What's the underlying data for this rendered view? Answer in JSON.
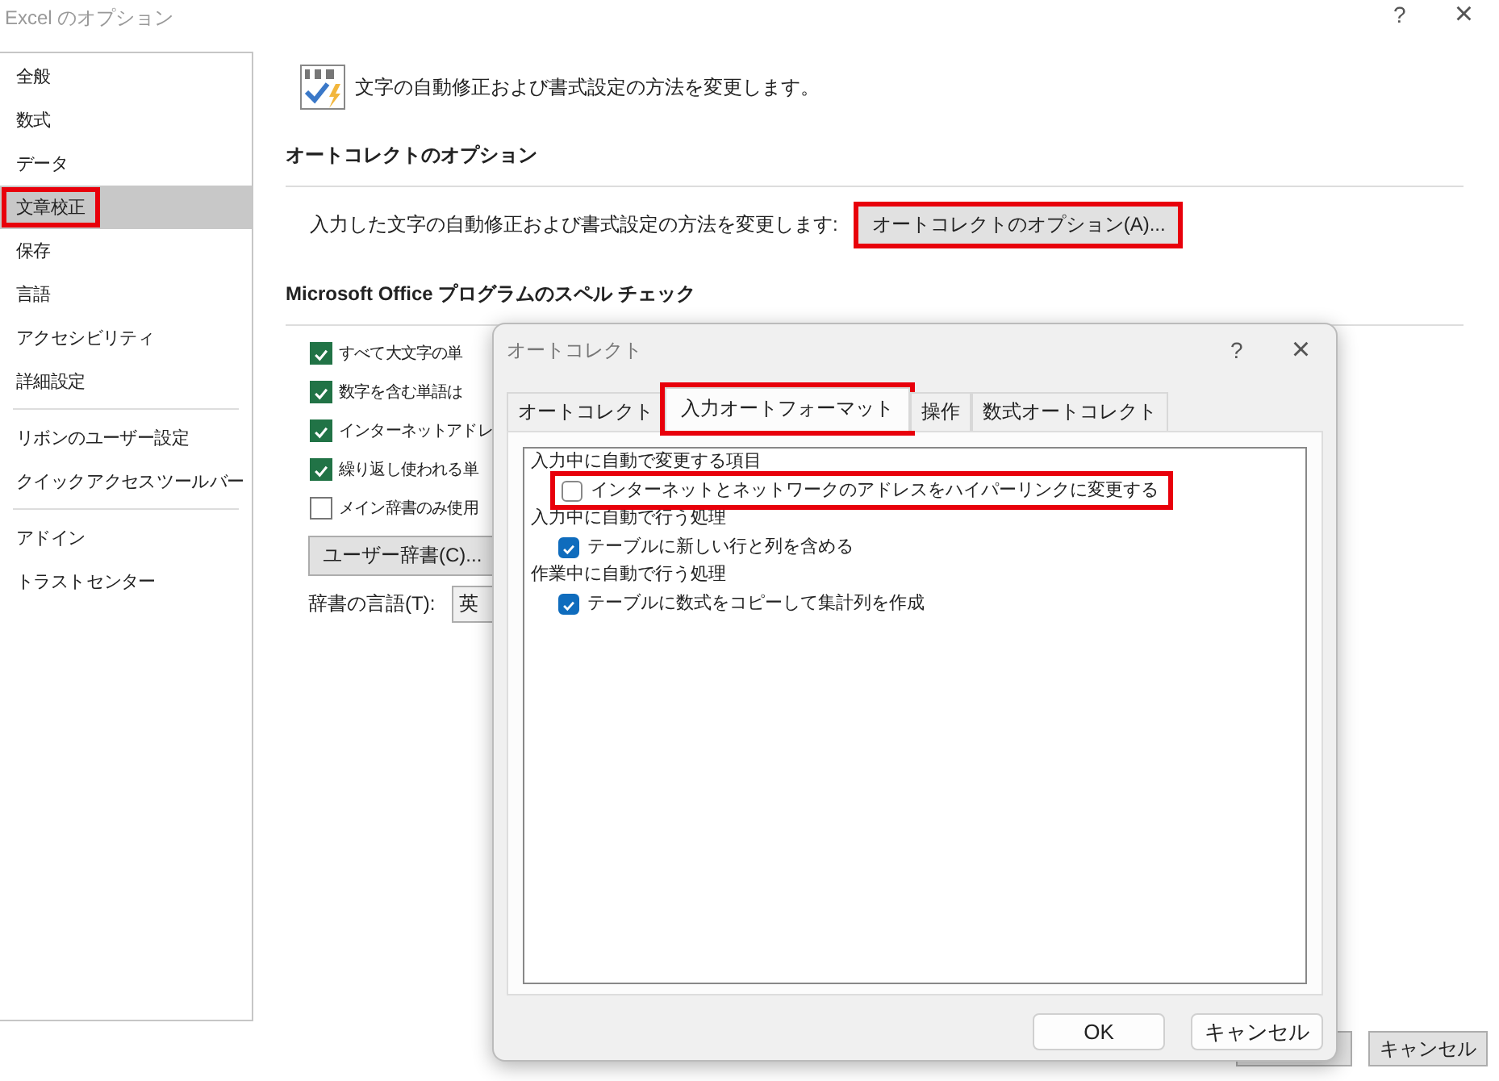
{
  "window": {
    "title": "Excel のオプション",
    "help": "?",
    "close": "×"
  },
  "sidebar": {
    "groups": [
      [
        {
          "label": "全般",
          "selected": false,
          "highlighted": false
        },
        {
          "label": "数式",
          "selected": false,
          "highlighted": false
        },
        {
          "label": "データ",
          "selected": false,
          "highlighted": false
        },
        {
          "label": "文章校正",
          "selected": true,
          "highlighted": true
        },
        {
          "label": "保存",
          "selected": false,
          "highlighted": false
        },
        {
          "label": "言語",
          "selected": false,
          "highlighted": false
        },
        {
          "label": "アクセシビリティ",
          "selected": false,
          "highlighted": false
        },
        {
          "label": "詳細設定",
          "selected": false,
          "highlighted": false
        }
      ],
      [
        {
          "label": "リボンのユーザー設定",
          "selected": false,
          "highlighted": false
        },
        {
          "label": "クイック アクセス ツール バー",
          "selected": false,
          "highlighted": false
        }
      ],
      [
        {
          "label": "アドイン",
          "selected": false,
          "highlighted": false
        },
        {
          "label": "トラスト センター",
          "selected": false,
          "highlighted": false
        }
      ]
    ]
  },
  "main": {
    "intro": "文字の自動修正および書式設定の方法を変更します。",
    "autocorrect_section": {
      "heading": "オートコレクトのオプション",
      "label": "入力した文字の自動修正および書式設定の方法を変更します:",
      "button": {
        "label": "オートコレクトのオプション(A)...",
        "highlighted": true
      }
    },
    "spelling_section": {
      "heading": "Microsoft Office プログラムのスペル チェック",
      "options": [
        {
          "label": "すべて大文字の単",
          "checked": true
        },
        {
          "label": "数字を含む単語は",
          "checked": true
        },
        {
          "label": "インターネット アドレ",
          "checked": true
        },
        {
          "label": "繰り返し使われる単",
          "checked": true
        },
        {
          "label": "メイン辞書のみ使用",
          "checked": false
        }
      ],
      "dictionary_button": "ユーザー辞書(C)...",
      "language_label": "辞書の言語(T):",
      "language_value": "英"
    }
  },
  "footer": {
    "cancel": "キャンセル"
  },
  "dialog": {
    "title": "オートコレクト",
    "help": "?",
    "close": "×",
    "tabs": [
      {
        "label": "オートコレクト",
        "selected": false,
        "highlighted": false
      },
      {
        "label": "入力オートフォーマット",
        "selected": true,
        "highlighted": true
      },
      {
        "label": "操作",
        "selected": false,
        "highlighted": false
      },
      {
        "label": "数式オートコレクト",
        "selected": false,
        "highlighted": false
      }
    ],
    "sections": [
      {
        "heading": "入力中に自動で変更する項目",
        "options": [
          {
            "label": "インターネットとネットワークのアドレスをハイパーリンクに変更する",
            "checked": false,
            "highlighted": true
          }
        ]
      },
      {
        "heading": "入力中に自動で行う処理",
        "options": [
          {
            "label": "テーブルに新しい行と列を含める",
            "checked": true,
            "highlighted": false
          }
        ]
      },
      {
        "heading": "作業中に自動で行う処理",
        "options": [
          {
            "label": "テーブルに数式をコピーして集計列を作成",
            "checked": true,
            "highlighted": false
          }
        ]
      }
    ],
    "buttons": [
      "OK",
      "キャンセル"
    ]
  }
}
